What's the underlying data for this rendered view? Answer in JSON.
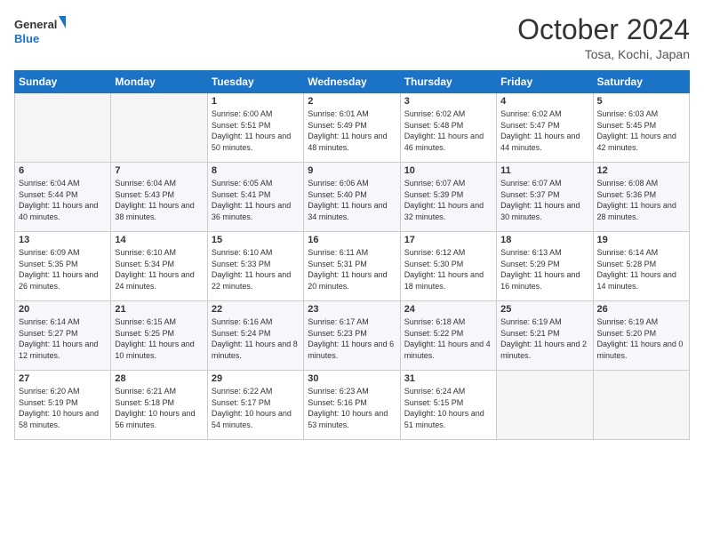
{
  "logo": {
    "line1": "General",
    "line2": "Blue"
  },
  "title": "October 2024",
  "location": "Tosa, Kochi, Japan",
  "days_of_week": [
    "Sunday",
    "Monday",
    "Tuesday",
    "Wednesday",
    "Thursday",
    "Friday",
    "Saturday"
  ],
  "weeks": [
    [
      {
        "day": "",
        "sunrise": "",
        "sunset": "",
        "daylight": ""
      },
      {
        "day": "",
        "sunrise": "",
        "sunset": "",
        "daylight": ""
      },
      {
        "day": "1",
        "sunrise": "Sunrise: 6:00 AM",
        "sunset": "Sunset: 5:51 PM",
        "daylight": "Daylight: 11 hours and 50 minutes."
      },
      {
        "day": "2",
        "sunrise": "Sunrise: 6:01 AM",
        "sunset": "Sunset: 5:49 PM",
        "daylight": "Daylight: 11 hours and 48 minutes."
      },
      {
        "day": "3",
        "sunrise": "Sunrise: 6:02 AM",
        "sunset": "Sunset: 5:48 PM",
        "daylight": "Daylight: 11 hours and 46 minutes."
      },
      {
        "day": "4",
        "sunrise": "Sunrise: 6:02 AM",
        "sunset": "Sunset: 5:47 PM",
        "daylight": "Daylight: 11 hours and 44 minutes."
      },
      {
        "day": "5",
        "sunrise": "Sunrise: 6:03 AM",
        "sunset": "Sunset: 5:45 PM",
        "daylight": "Daylight: 11 hours and 42 minutes."
      }
    ],
    [
      {
        "day": "6",
        "sunrise": "Sunrise: 6:04 AM",
        "sunset": "Sunset: 5:44 PM",
        "daylight": "Daylight: 11 hours and 40 minutes."
      },
      {
        "day": "7",
        "sunrise": "Sunrise: 6:04 AM",
        "sunset": "Sunset: 5:43 PM",
        "daylight": "Daylight: 11 hours and 38 minutes."
      },
      {
        "day": "8",
        "sunrise": "Sunrise: 6:05 AM",
        "sunset": "Sunset: 5:41 PM",
        "daylight": "Daylight: 11 hours and 36 minutes."
      },
      {
        "day": "9",
        "sunrise": "Sunrise: 6:06 AM",
        "sunset": "Sunset: 5:40 PM",
        "daylight": "Daylight: 11 hours and 34 minutes."
      },
      {
        "day": "10",
        "sunrise": "Sunrise: 6:07 AM",
        "sunset": "Sunset: 5:39 PM",
        "daylight": "Daylight: 11 hours and 32 minutes."
      },
      {
        "day": "11",
        "sunrise": "Sunrise: 6:07 AM",
        "sunset": "Sunset: 5:37 PM",
        "daylight": "Daylight: 11 hours and 30 minutes."
      },
      {
        "day": "12",
        "sunrise": "Sunrise: 6:08 AM",
        "sunset": "Sunset: 5:36 PM",
        "daylight": "Daylight: 11 hours and 28 minutes."
      }
    ],
    [
      {
        "day": "13",
        "sunrise": "Sunrise: 6:09 AM",
        "sunset": "Sunset: 5:35 PM",
        "daylight": "Daylight: 11 hours and 26 minutes."
      },
      {
        "day": "14",
        "sunrise": "Sunrise: 6:10 AM",
        "sunset": "Sunset: 5:34 PM",
        "daylight": "Daylight: 11 hours and 24 minutes."
      },
      {
        "day": "15",
        "sunrise": "Sunrise: 6:10 AM",
        "sunset": "Sunset: 5:33 PM",
        "daylight": "Daylight: 11 hours and 22 minutes."
      },
      {
        "day": "16",
        "sunrise": "Sunrise: 6:11 AM",
        "sunset": "Sunset: 5:31 PM",
        "daylight": "Daylight: 11 hours and 20 minutes."
      },
      {
        "day": "17",
        "sunrise": "Sunrise: 6:12 AM",
        "sunset": "Sunset: 5:30 PM",
        "daylight": "Daylight: 11 hours and 18 minutes."
      },
      {
        "day": "18",
        "sunrise": "Sunrise: 6:13 AM",
        "sunset": "Sunset: 5:29 PM",
        "daylight": "Daylight: 11 hours and 16 minutes."
      },
      {
        "day": "19",
        "sunrise": "Sunrise: 6:14 AM",
        "sunset": "Sunset: 5:28 PM",
        "daylight": "Daylight: 11 hours and 14 minutes."
      }
    ],
    [
      {
        "day": "20",
        "sunrise": "Sunrise: 6:14 AM",
        "sunset": "Sunset: 5:27 PM",
        "daylight": "Daylight: 11 hours and 12 minutes."
      },
      {
        "day": "21",
        "sunrise": "Sunrise: 6:15 AM",
        "sunset": "Sunset: 5:25 PM",
        "daylight": "Daylight: 11 hours and 10 minutes."
      },
      {
        "day": "22",
        "sunrise": "Sunrise: 6:16 AM",
        "sunset": "Sunset: 5:24 PM",
        "daylight": "Daylight: 11 hours and 8 minutes."
      },
      {
        "day": "23",
        "sunrise": "Sunrise: 6:17 AM",
        "sunset": "Sunset: 5:23 PM",
        "daylight": "Daylight: 11 hours and 6 minutes."
      },
      {
        "day": "24",
        "sunrise": "Sunrise: 6:18 AM",
        "sunset": "Sunset: 5:22 PM",
        "daylight": "Daylight: 11 hours and 4 minutes."
      },
      {
        "day": "25",
        "sunrise": "Sunrise: 6:19 AM",
        "sunset": "Sunset: 5:21 PM",
        "daylight": "Daylight: 11 hours and 2 minutes."
      },
      {
        "day": "26",
        "sunrise": "Sunrise: 6:19 AM",
        "sunset": "Sunset: 5:20 PM",
        "daylight": "Daylight: 11 hours and 0 minutes."
      }
    ],
    [
      {
        "day": "27",
        "sunrise": "Sunrise: 6:20 AM",
        "sunset": "Sunset: 5:19 PM",
        "daylight": "Daylight: 10 hours and 58 minutes."
      },
      {
        "day": "28",
        "sunrise": "Sunrise: 6:21 AM",
        "sunset": "Sunset: 5:18 PM",
        "daylight": "Daylight: 10 hours and 56 minutes."
      },
      {
        "day": "29",
        "sunrise": "Sunrise: 6:22 AM",
        "sunset": "Sunset: 5:17 PM",
        "daylight": "Daylight: 10 hours and 54 minutes."
      },
      {
        "day": "30",
        "sunrise": "Sunrise: 6:23 AM",
        "sunset": "Sunset: 5:16 PM",
        "daylight": "Daylight: 10 hours and 53 minutes."
      },
      {
        "day": "31",
        "sunrise": "Sunrise: 6:24 AM",
        "sunset": "Sunset: 5:15 PM",
        "daylight": "Daylight: 10 hours and 51 minutes."
      },
      {
        "day": "",
        "sunrise": "",
        "sunset": "",
        "daylight": ""
      },
      {
        "day": "",
        "sunrise": "",
        "sunset": "",
        "daylight": ""
      }
    ]
  ]
}
